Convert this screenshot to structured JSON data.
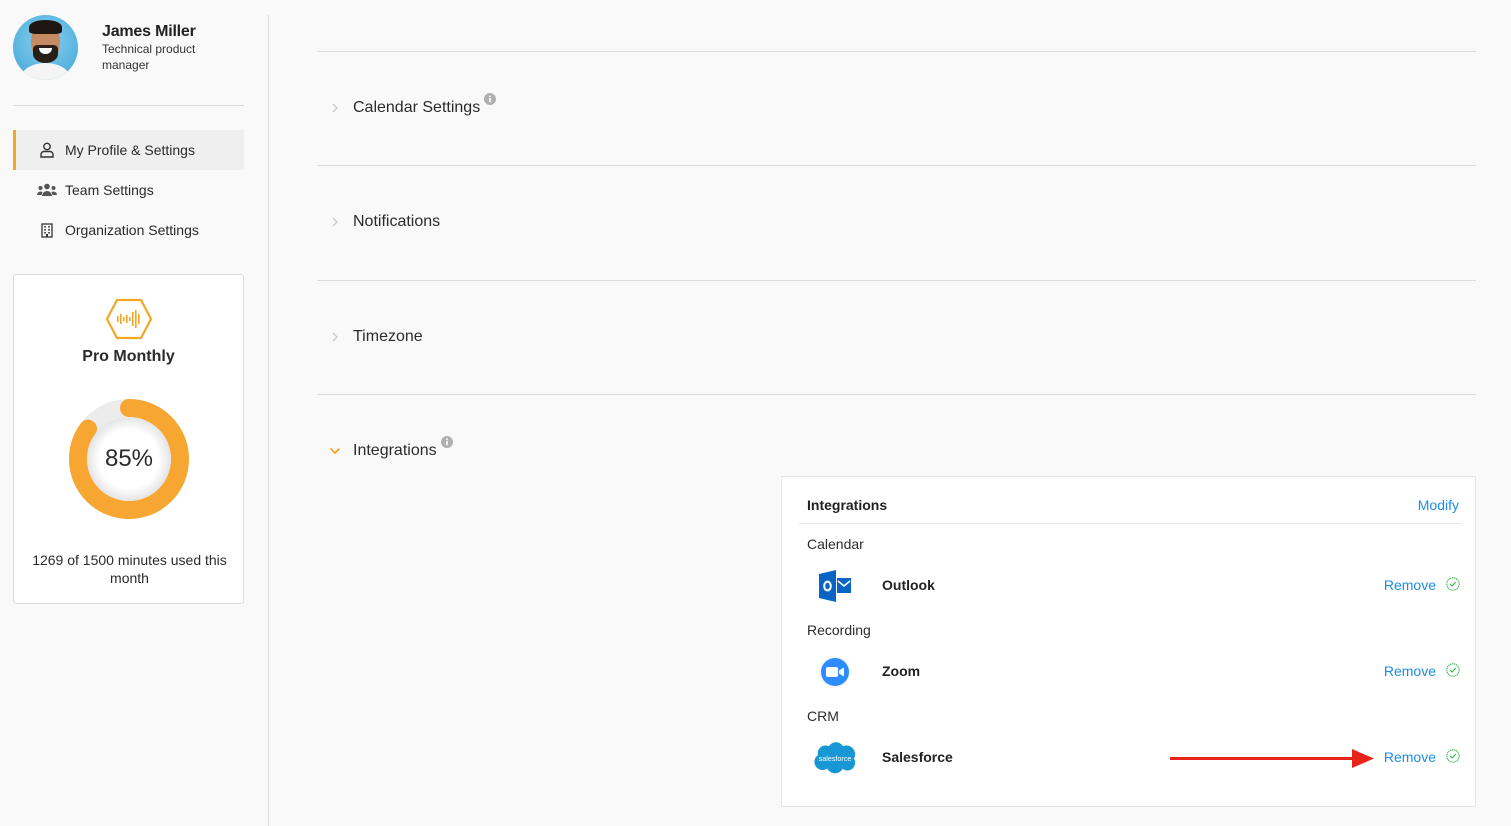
{
  "sidebar": {
    "profile": {
      "name": "James Miller",
      "role": "Technical product manager"
    },
    "nav": [
      {
        "label": "My Profile & Settings",
        "icon": "user-icon",
        "active": true
      },
      {
        "label": "Team Settings",
        "icon": "team-icon",
        "active": false
      },
      {
        "label": "Organization Settings",
        "icon": "building-icon",
        "active": false
      }
    ],
    "plan": {
      "name": "Pro Monthly",
      "icon": "audio-wave-hexagon-icon",
      "percent_label": "85%",
      "percent_used": 85,
      "minutes_used": 1269,
      "minutes_total": 1500,
      "usage_text": "1269 of 1500 minutes used this month"
    }
  },
  "main": {
    "sections": [
      {
        "title": "Calendar Settings",
        "expanded": false,
        "has_info": true
      },
      {
        "title": "Notifications",
        "expanded": false,
        "has_info": false
      },
      {
        "title": "Timezone",
        "expanded": false,
        "has_info": false
      },
      {
        "title": "Integrations",
        "expanded": true,
        "has_info": true
      }
    ],
    "integrations_card": {
      "title": "Integrations",
      "modify_label": "Modify",
      "groups": [
        {
          "category": "Calendar",
          "items": [
            {
              "name": "Outlook",
              "logo": "outlook-logo",
              "action": "Remove",
              "status": "connected"
            }
          ]
        },
        {
          "category": "Recording",
          "items": [
            {
              "name": "Zoom",
              "logo": "zoom-logo",
              "action": "Remove",
              "status": "connected"
            }
          ]
        },
        {
          "category": "CRM",
          "items": [
            {
              "name": "Salesforce",
              "logo": "salesforce-logo",
              "logo_text": "salesforce",
              "action": "Remove",
              "status": "connected"
            }
          ]
        }
      ]
    }
  },
  "colors": {
    "accent": "#f5a623",
    "link": "#1a8ee6",
    "success": "#2fb344",
    "annotation": "#e8231a",
    "outlook": "#0a64c4",
    "zoom": "#2d8cff",
    "salesforce": "#1798d4"
  }
}
